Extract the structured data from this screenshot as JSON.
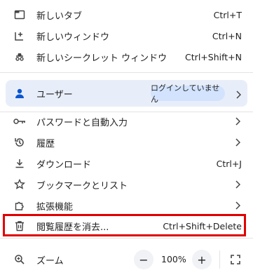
{
  "items": {
    "new_tab": {
      "label": "新しいタブ",
      "shortcut": "Ctrl+T",
      "icon": "new-tab-icon"
    },
    "new_window": {
      "label": "新しいウィンドウ",
      "shortcut": "Ctrl+N",
      "icon": "new-window-icon"
    },
    "incognito": {
      "label": "新しいシークレット ウィンドウ",
      "shortcut": "Ctrl+Shift+N",
      "icon": "incognito-icon"
    },
    "user": {
      "label": "ユーザー",
      "badge": "ログインしていません",
      "icon": "person-icon"
    },
    "passwords": {
      "label": "パスワードと自動入力",
      "icon": "key-icon"
    },
    "history": {
      "label": "履歴",
      "icon": "history-icon"
    },
    "downloads": {
      "label": "ダウンロード",
      "shortcut": "Ctrl+J",
      "icon": "download-icon"
    },
    "bookmarks": {
      "label": "ブックマークとリスト",
      "icon": "star-icon"
    },
    "extensions": {
      "label": "拡張機能",
      "icon": "puzzle-icon"
    },
    "clear_data": {
      "label": "閲覧履歴を消去...",
      "shortcut": "Ctrl+Shift+Delete",
      "icon": "trash-icon"
    }
  },
  "zoom": {
    "label": "ズーム",
    "value": "100%",
    "minus": "−",
    "plus": "+"
  },
  "colors": {
    "highlight": "#e00000",
    "user_card": "#e8eef9",
    "badge": "#d3e3fd"
  }
}
